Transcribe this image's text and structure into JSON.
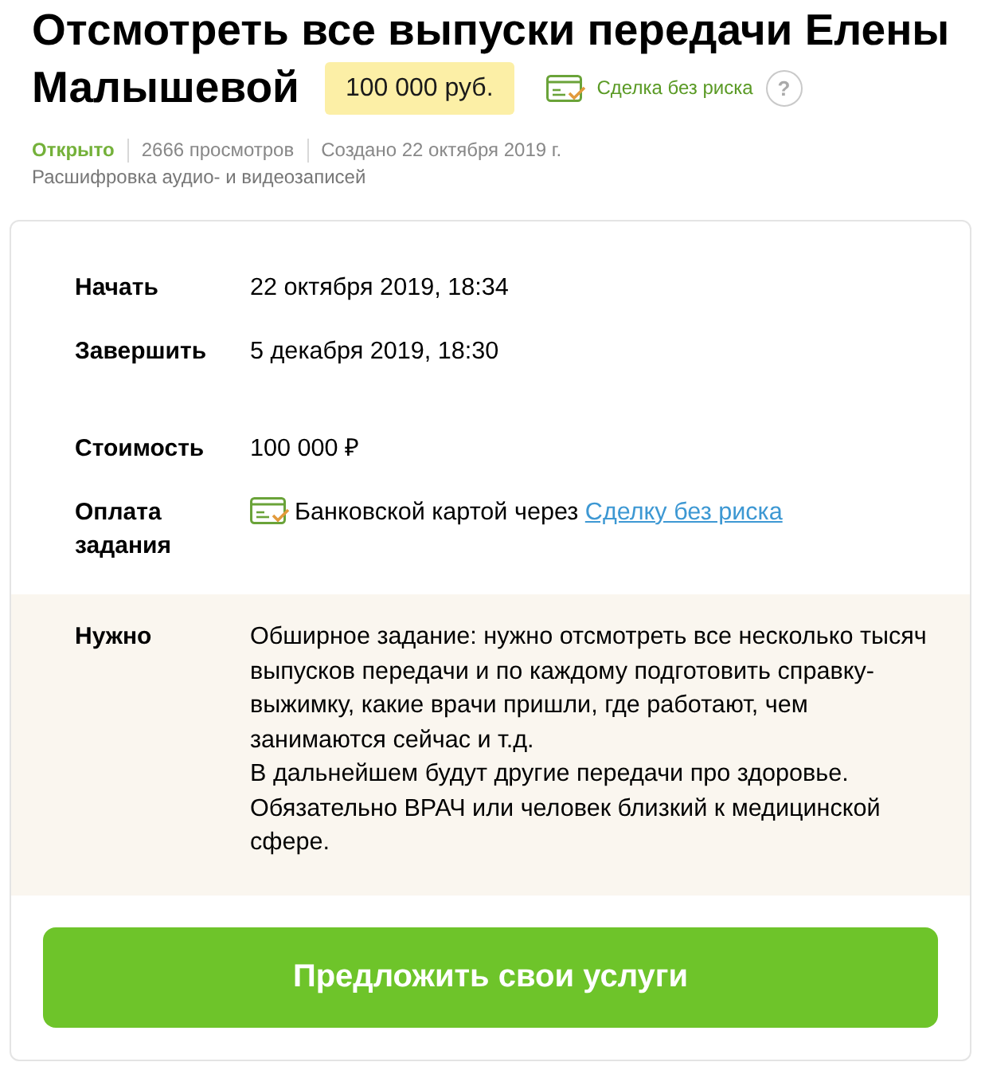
{
  "title_lines": [
    "Отсмотреть все выпуски передачи Елены",
    "Малышевой"
  ],
  "price_badge": "100 000 руб.",
  "safe_deal": {
    "label": "Сделка без риска",
    "help": "?"
  },
  "meta": {
    "status": "Открыто",
    "views": "2666 просмотров",
    "created": "Создано 22 октября 2019 г.",
    "category": "Расшифровка аудио- и видеозаписей"
  },
  "schedule": [
    {
      "label": "Начать",
      "value": "22 октября 2019, 18:34"
    },
    {
      "label": "Завершить",
      "value": "5 декабря 2019, 18:30"
    }
  ],
  "cost": {
    "label": "Стоимость",
    "value": "100 000 ₽"
  },
  "payment": {
    "label": "Оплата задания",
    "text": "Банковской картой через",
    "link": "Сделку без риска"
  },
  "requirements": {
    "label": "Нужно",
    "paragraphs": [
      "Обширное задание: нужно отсмотреть все несколько тысяч выпусков передачи и по каждому подготовить справку-выжимку, какие врачи пришли, где работают, чем занимаются сейчас и т.д.",
      "В дальнейшем будут другие передачи про здоровье.",
      "Обязательно ВРАЧ или человек близкий к медицинской сфере."
    ]
  },
  "action_button": "Предложить свои услуги"
}
